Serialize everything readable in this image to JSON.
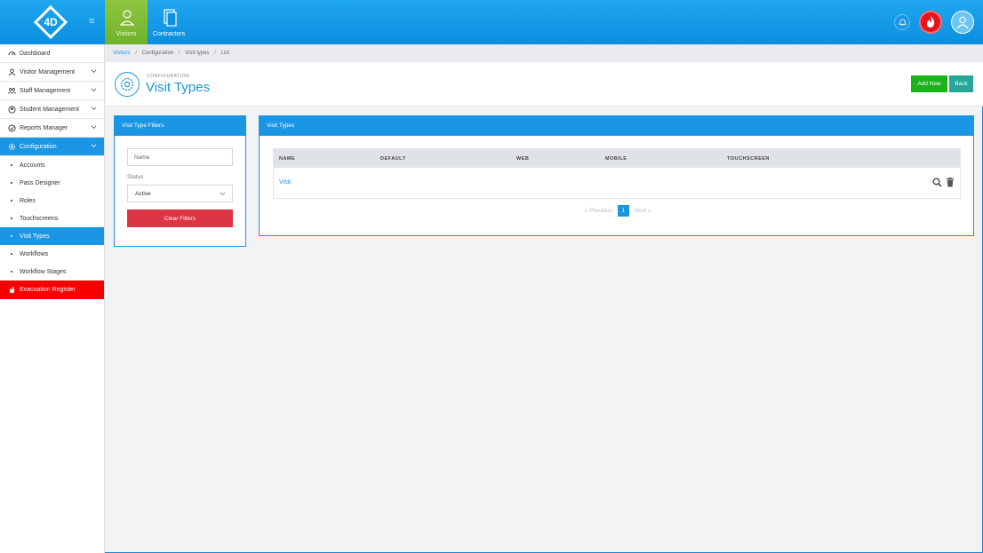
{
  "brand": {
    "logo_text": "4D"
  },
  "topnav": [
    {
      "label": "Visitors",
      "active": true
    },
    {
      "label": "Contractors",
      "active": false
    }
  ],
  "sidebar": {
    "items": [
      {
        "label": "Dashboard",
        "icon": "dashboard-icon"
      },
      {
        "label": "Visitor Management",
        "icon": "user-icon"
      },
      {
        "label": "Staff Management",
        "icon": "staff-icon"
      },
      {
        "label": "Student Management",
        "icon": "student-icon"
      },
      {
        "label": "Reports Manager",
        "icon": "reports-icon"
      },
      {
        "label": "Configuration",
        "icon": "gear-icon"
      }
    ],
    "sub_items": [
      {
        "label": "Accounts"
      },
      {
        "label": "Pass Designer"
      },
      {
        "label": "Roles"
      },
      {
        "label": "Touchscreens"
      },
      {
        "label": "Visit Types"
      },
      {
        "label": "Workflows"
      },
      {
        "label": "Workflow Stages"
      }
    ],
    "evacuation": "Evacuation Register"
  },
  "breadcrumb": {
    "root": "Visitors",
    "items": [
      "Configuration",
      "Visit types",
      "List"
    ]
  },
  "header": {
    "kicker": "CONFIGURATION",
    "title": "Visit Types",
    "add_label": "Add New",
    "back_label": "Back"
  },
  "filters": {
    "title": "Visit Type Filters",
    "name_placeholder": "Name",
    "status_label": "Status",
    "status_value": "Active",
    "clear_label": "Clear Filters"
  },
  "types": {
    "title": "Visit Types",
    "columns": [
      "NAME",
      "DEFAULT",
      "WEB",
      "MOBILE",
      "TOUCHSCREEN"
    ],
    "rows": [
      {
        "name": "Visit"
      }
    ],
    "pager": {
      "previous": "Previous",
      "next": "Next",
      "current": "1"
    }
  },
  "colors": {
    "primary": "#1a96e4",
    "success": "#1ab31a",
    "danger": "#dc3545",
    "evac": "#f80000",
    "visitors_active": "#8fc63f"
  }
}
